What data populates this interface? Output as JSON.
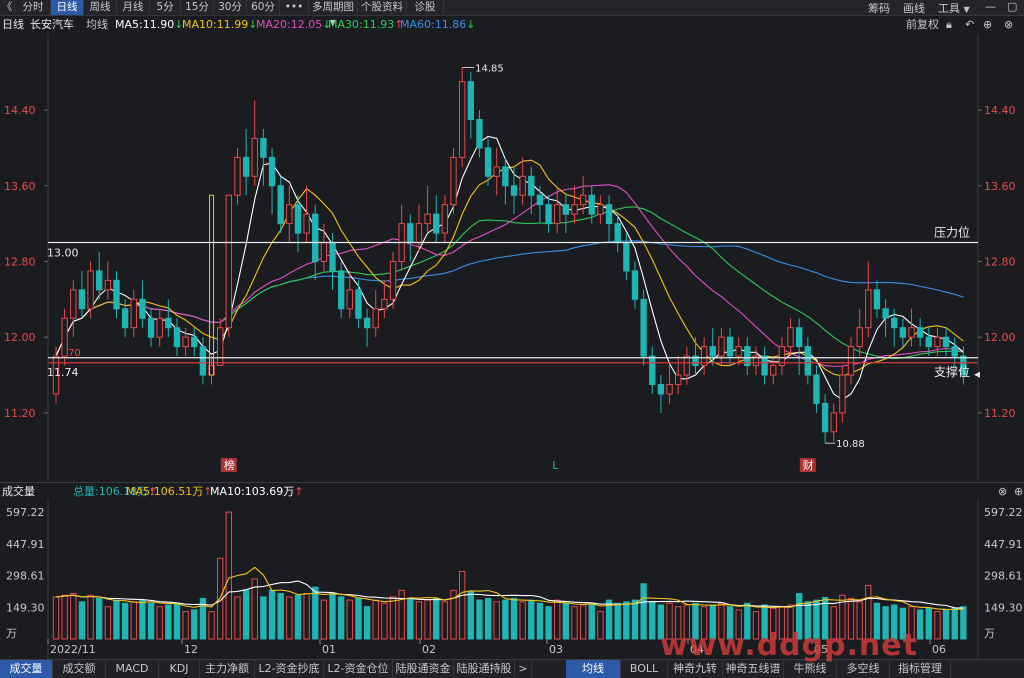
{
  "toolbar": {
    "back": "《",
    "tabs": [
      "分时",
      "日线",
      "周线",
      "月线",
      "5分",
      "15分",
      "30分",
      "60分",
      "•••",
      "多周期图",
      "个股资料",
      "诊股"
    ],
    "active_tab": "日线",
    "dropdown_arrow": "▼",
    "right": {
      "code": "筹码",
      "draw": "画线",
      "tools": "工具",
      "tools_arrow": "▼"
    }
  },
  "indicators": {
    "period": "日线",
    "stock_name": "长安汽车",
    "ma_label": "均线",
    "ma5": "MA5:11.90",
    "ma10": "MA10:11.99",
    "ma20": "MA20:12.05",
    "ma30": "MA30:11.93",
    "ma60": "MA60:11.86",
    "fq": "前复权",
    "icons": [
      "lock-icon",
      "undo-icon",
      "add-icon",
      "close-icon"
    ],
    "colors": {
      "ma5": "#ffffff",
      "ma10": "#f2c21b",
      "ma20": "#e04fc0",
      "ma30": "#2ec95a",
      "ma60": "#3a8ee6",
      "up": "#e84a4a",
      "down": "#1fb5b5"
    }
  },
  "price_axis": {
    "left_labels": [
      "14.40",
      "13.60",
      "12.80",
      "12.00",
      "11.20"
    ],
    "right_labels": [
      "14.40",
      "13.60",
      "12.80",
      "12.00",
      "11.20"
    ]
  },
  "lines": {
    "resistance_label": "压力位",
    "support_label": "支撑位",
    "resistance_value": "13.00",
    "support_value": "11.74",
    "support_partial": "70"
  },
  "annotations": {
    "high": "14.85",
    "low": "10.88",
    "badge1": "榜",
    "badge2": "L",
    "badge3": "财"
  },
  "volume": {
    "title": "成交量",
    "total": "总量:106.18万",
    "ma5": "MA5:106.51万",
    "ma10": "MA10:103.69万",
    "left_labels": [
      "597.22",
      "447.91",
      "298.61",
      "149.30",
      "万"
    ],
    "right_labels": [
      "597.22",
      "447.91",
      "298.61",
      "149.30",
      "万"
    ]
  },
  "dates": [
    "2022/11",
    "12",
    "01",
    "02",
    "03",
    "04",
    "05",
    "06"
  ],
  "bottom_tabs": {
    "left": [
      "成交量",
      "成交额",
      "MACD",
      "KDJ",
      "主力净额",
      "L2-资金抄底",
      "L2-资金仓位",
      "陆股通资金",
      "陆股通持股"
    ],
    "arrow": ">",
    "right": [
      "均线",
      "BOLL",
      "神奇九转",
      "神奇五线谱",
      "牛熊线",
      "多空线",
      "指标管理"
    ]
  },
  "watermark": "www.ddgp.net",
  "chart_data": {
    "type": "candlestick",
    "ma_lines": [
      "MA5",
      "MA10",
      "MA20",
      "MA30",
      "MA60"
    ],
    "ylim": [
      10.85,
      14.95
    ],
    "marked_high": 14.85,
    "marked_low": 10.88,
    "resistance": 13.0,
    "support": 11.74,
    "candles": [
      [
        11.4,
        11.8,
        11.3,
        11.9
      ],
      [
        11.8,
        12.2,
        11.7,
        12.3
      ],
      [
        12.2,
        12.5,
        12.0,
        12.6
      ],
      [
        12.5,
        12.3,
        12.2,
        12.7
      ],
      [
        12.3,
        12.7,
        12.2,
        12.8
      ],
      [
        12.7,
        12.5,
        12.4,
        12.9
      ],
      [
        12.5,
        12.6,
        12.4,
        12.8
      ],
      [
        12.6,
        12.3,
        12.2,
        12.7
      ],
      [
        12.3,
        12.1,
        12.0,
        12.4
      ],
      [
        12.1,
        12.4,
        12.0,
        12.5
      ],
      [
        12.4,
        12.2,
        12.1,
        12.6
      ],
      [
        12.2,
        12.0,
        11.9,
        12.3
      ],
      [
        12.0,
        12.2,
        11.9,
        12.3
      ],
      [
        12.2,
        12.1,
        12.0,
        12.4
      ],
      [
        12.1,
        11.9,
        11.8,
        12.2
      ],
      [
        11.9,
        12.0,
        11.8,
        12.1
      ],
      [
        12.0,
        11.9,
        11.8,
        12.1
      ],
      [
        11.9,
        11.6,
        11.5,
        12.0
      ],
      [
        11.6,
        11.7,
        11.5,
        11.8
      ],
      [
        11.7,
        12.1,
        11.7,
        12.2
      ],
      [
        12.1,
        13.5,
        12.0,
        13.5
      ],
      [
        13.5,
        13.9,
        13.4,
        14.0
      ],
      [
        13.9,
        13.7,
        13.5,
        14.2
      ],
      [
        13.7,
        14.1,
        13.6,
        14.5
      ],
      [
        14.1,
        13.9,
        13.6,
        14.2
      ],
      [
        13.9,
        13.6,
        13.3,
        14.0
      ],
      [
        13.6,
        13.2,
        13.1,
        13.7
      ],
      [
        13.2,
        13.4,
        13.0,
        13.6
      ],
      [
        13.4,
        13.1,
        12.9,
        13.5
      ],
      [
        13.1,
        13.3,
        13.0,
        13.6
      ],
      [
        13.3,
        12.8,
        12.6,
        13.4
      ],
      [
        12.8,
        13.0,
        12.7,
        13.2
      ],
      [
        13.0,
        12.7,
        12.5,
        13.1
      ],
      [
        12.7,
        12.3,
        12.2,
        12.8
      ],
      [
        12.3,
        12.5,
        12.2,
        12.7
      ],
      [
        12.5,
        12.2,
        12.1,
        12.6
      ],
      [
        12.2,
        12.1,
        11.9,
        12.3
      ],
      [
        12.1,
        12.3,
        12.0,
        12.5
      ],
      [
        12.3,
        12.4,
        12.2,
        12.6
      ],
      [
        12.4,
        12.8,
        12.3,
        12.9
      ],
      [
        12.8,
        13.2,
        12.7,
        13.4
      ],
      [
        13.2,
        13.0,
        12.8,
        13.3
      ],
      [
        13.0,
        13.2,
        12.9,
        13.4
      ],
      [
        13.2,
        13.3,
        13.1,
        13.6
      ],
      [
        13.3,
        13.1,
        13.0,
        13.5
      ],
      [
        13.1,
        13.4,
        13.0,
        13.5
      ],
      [
        13.4,
        13.9,
        13.3,
        14.0
      ],
      [
        13.9,
        14.7,
        13.8,
        14.85
      ],
      [
        14.7,
        14.3,
        14.1,
        14.8
      ],
      [
        14.3,
        14.0,
        13.9,
        14.4
      ],
      [
        14.0,
        13.7,
        13.6,
        14.1
      ],
      [
        13.7,
        13.8,
        13.5,
        14.0
      ],
      [
        13.8,
        13.6,
        13.4,
        13.9
      ],
      [
        13.6,
        13.5,
        13.3,
        13.8
      ],
      [
        13.5,
        13.7,
        13.4,
        13.9
      ],
      [
        13.7,
        13.5,
        13.3,
        13.8
      ],
      [
        13.5,
        13.4,
        13.2,
        13.6
      ],
      [
        13.4,
        13.2,
        13.1,
        13.5
      ],
      [
        13.2,
        13.4,
        13.1,
        13.6
      ],
      [
        13.4,
        13.3,
        13.1,
        13.5
      ],
      [
        13.3,
        13.4,
        13.2,
        13.6
      ],
      [
        13.4,
        13.5,
        13.3,
        13.7
      ],
      [
        13.5,
        13.3,
        13.2,
        13.6
      ],
      [
        13.3,
        13.4,
        13.2,
        13.5
      ],
      [
        13.4,
        13.2,
        13.0,
        13.5
      ],
      [
        13.2,
        13.0,
        12.9,
        13.3
      ],
      [
        13.0,
        12.7,
        12.6,
        13.1
      ],
      [
        12.7,
        12.4,
        12.3,
        12.8
      ],
      [
        12.4,
        11.8,
        11.7,
        12.5
      ],
      [
        11.8,
        11.5,
        11.4,
        11.9
      ],
      [
        11.5,
        11.4,
        11.2,
        11.6
      ],
      [
        11.4,
        11.5,
        11.3,
        11.7
      ],
      [
        11.5,
        11.6,
        11.4,
        11.8
      ],
      [
        11.6,
        11.8,
        11.5,
        11.9
      ],
      [
        11.8,
        11.7,
        11.6,
        12.0
      ],
      [
        11.7,
        11.9,
        11.6,
        12.0
      ],
      [
        11.9,
        11.8,
        11.7,
        12.1
      ],
      [
        11.8,
        12.0,
        11.7,
        12.1
      ],
      [
        12.0,
        11.8,
        11.7,
        12.1
      ],
      [
        11.8,
        11.9,
        11.7,
        12.0
      ],
      [
        11.9,
        11.7,
        11.6,
        12.0
      ],
      [
        11.7,
        11.8,
        11.6,
        11.9
      ],
      [
        11.8,
        11.6,
        11.5,
        11.9
      ],
      [
        11.6,
        11.7,
        11.5,
        11.8
      ],
      [
        11.7,
        11.9,
        11.6,
        12.0
      ],
      [
        11.9,
        12.1,
        11.8,
        12.2
      ],
      [
        12.1,
        11.9,
        11.6,
        12.2
      ],
      [
        11.9,
        11.6,
        11.5,
        12.0
      ],
      [
        11.6,
        11.3,
        11.2,
        11.7
      ],
      [
        11.3,
        11.0,
        10.88,
        11.4
      ],
      [
        11.0,
        11.2,
        10.9,
        11.3
      ],
      [
        11.2,
        11.6,
        11.1,
        11.7
      ],
      [
        11.6,
        11.9,
        11.5,
        12.0
      ],
      [
        11.9,
        12.1,
        11.8,
        12.3
      ],
      [
        12.1,
        12.5,
        12.0,
        12.8
      ],
      [
        12.5,
        12.3,
        12.2,
        12.6
      ],
      [
        12.3,
        12.2,
        12.0,
        12.4
      ],
      [
        12.2,
        12.1,
        11.9,
        12.3
      ],
      [
        12.1,
        12.0,
        11.9,
        12.2
      ],
      [
        12.0,
        12.1,
        11.9,
        12.3
      ],
      [
        12.1,
        12.0,
        11.9,
        12.2
      ],
      [
        12.0,
        11.9,
        11.8,
        12.1
      ],
      [
        11.9,
        12.0,
        11.8,
        12.1
      ],
      [
        12.0,
        11.9,
        11.8,
        12.1
      ],
      [
        11.9,
        11.8,
        11.7,
        12.0
      ],
      [
        11.8,
        11.6,
        11.5,
        11.9
      ]
    ],
    "volume_ylim": [
      0,
      640
    ],
    "volume_labels": [
      "597.22",
      "447.91",
      "298.61",
      "149.30"
    ]
  }
}
